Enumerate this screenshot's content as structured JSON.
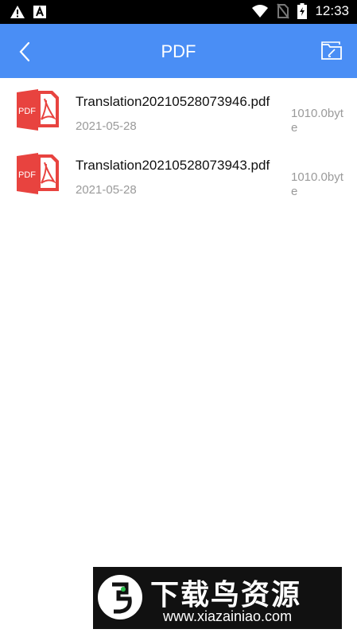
{
  "status_bar": {
    "time": "12:33",
    "icons": [
      "warning-icon",
      "a-app-icon",
      "wifi-icon",
      "no-sim-icon",
      "battery-charging-icon"
    ]
  },
  "header": {
    "title": "PDF",
    "back_icon": "chevron-left-icon",
    "action_icon": "folder-edit-icon",
    "background": "#4a8ef5"
  },
  "files": [
    {
      "name": "Translation20210528073946.pdf",
      "date": "2021-05-28",
      "size": "1010.0byte",
      "icon": "pdf-file-icon",
      "icon_label": "PDF"
    },
    {
      "name": "Translation20210528073943.pdf",
      "date": "2021-05-28",
      "size": "1010.0byte",
      "icon": "pdf-file-icon",
      "icon_label": "PDF"
    }
  ],
  "watermark": {
    "title": "下载鸟资源",
    "url": "www.xiazainiao.com"
  },
  "colors": {
    "pdf_red": "#e8433f",
    "text_secondary": "#9a9a9a"
  }
}
